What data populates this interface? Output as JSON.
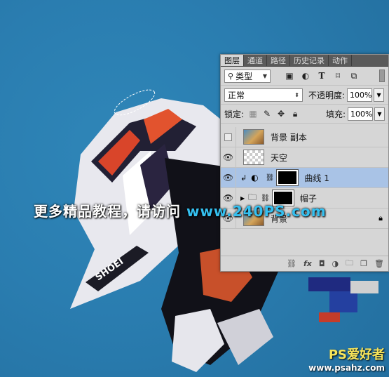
{
  "panel": {
    "tabs": [
      "图层",
      "通道",
      "路径",
      "历史记录",
      "动作"
    ],
    "active_tab": 0,
    "filter": {
      "label": "类型",
      "icons": [
        "image-filter-icon",
        "adjustment-filter-icon",
        "type-filter-icon",
        "shape-filter-icon",
        "smart-object-filter-icon"
      ]
    },
    "blend_mode": "正常",
    "opacity_label": "不透明度:",
    "opacity_value": "100%",
    "lock_label": "锁定:",
    "fill_label": "填充:",
    "fill_value": "100%"
  },
  "layers": [
    {
      "name": "背景 副本",
      "visible": false,
      "thumb": "photo"
    },
    {
      "name": "天空",
      "visible": true,
      "thumb": "transparent"
    },
    {
      "name": "曲线 1",
      "visible": true,
      "thumb": "black",
      "selected": true,
      "clipped": true,
      "adjustment": true
    },
    {
      "name": "帽子",
      "visible": true,
      "thumb": "black",
      "group": true
    },
    {
      "name": "背景",
      "visible": true,
      "thumb": "photo"
    }
  ],
  "bottom_icons": [
    "link-icon",
    "fx-icon",
    "mask-icon",
    "adjustment-icon",
    "group-icon",
    "new-layer-icon",
    "trash-icon"
  ],
  "watermark": {
    "text": "更多精品教程，请访问 ",
    "url": "www.240PS.com"
  },
  "logo": {
    "line1": "PS爱好者",
    "line2": "www.psahz.com"
  }
}
